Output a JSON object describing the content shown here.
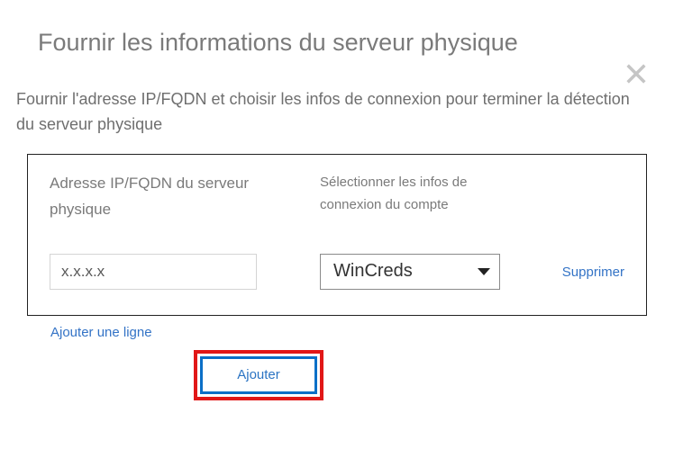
{
  "title": "Fournir les informations du serveur physique",
  "instruction": "Fournir l'adresse IP/FQDN et choisir les infos de connexion pour terminer la détection du serveur physique",
  "form": {
    "ip_label": "Adresse IP/FQDN du serveur physique",
    "creds_label": "Sélectionner les infos de connexion du compte",
    "ip_value": "x.x.x.x",
    "creds_selected": "WinCreds",
    "delete_label": "Supprimer"
  },
  "actions": {
    "add_line": "Ajouter une ligne",
    "add_button": "Ajouter"
  }
}
